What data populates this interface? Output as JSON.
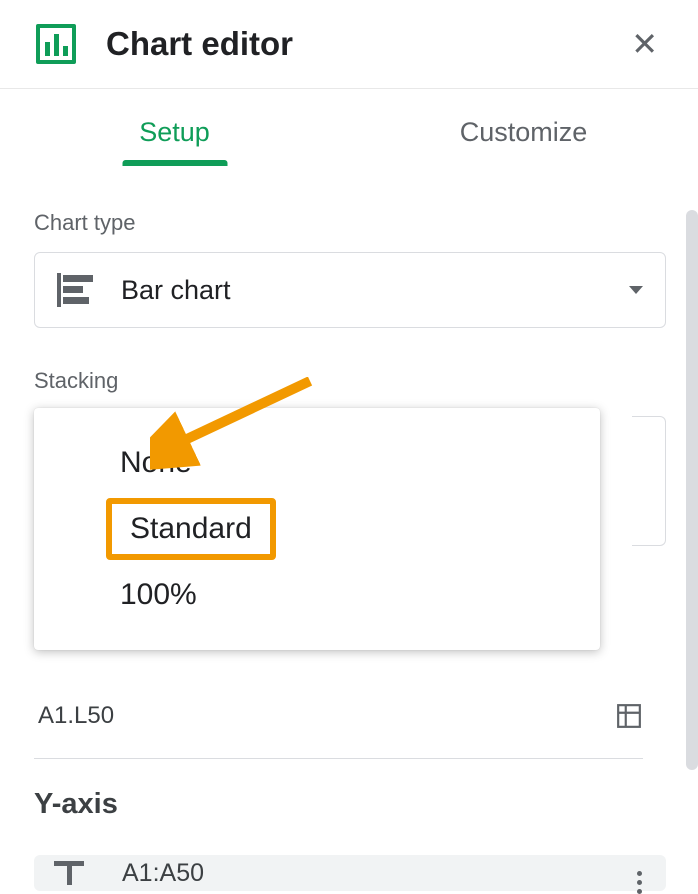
{
  "header": {
    "title": "Chart editor"
  },
  "tabs": {
    "setup": "Setup",
    "customize": "Customize"
  },
  "chart_type": {
    "label": "Chart type",
    "selected": "Bar chart"
  },
  "stacking": {
    "label": "Stacking",
    "options": {
      "none": "None",
      "standard": "Standard",
      "hundred": "100%"
    }
  },
  "data_range_partial": "A1.L50",
  "yaxis": {
    "title": "Y-axis",
    "range_partial": "A1:A50"
  }
}
